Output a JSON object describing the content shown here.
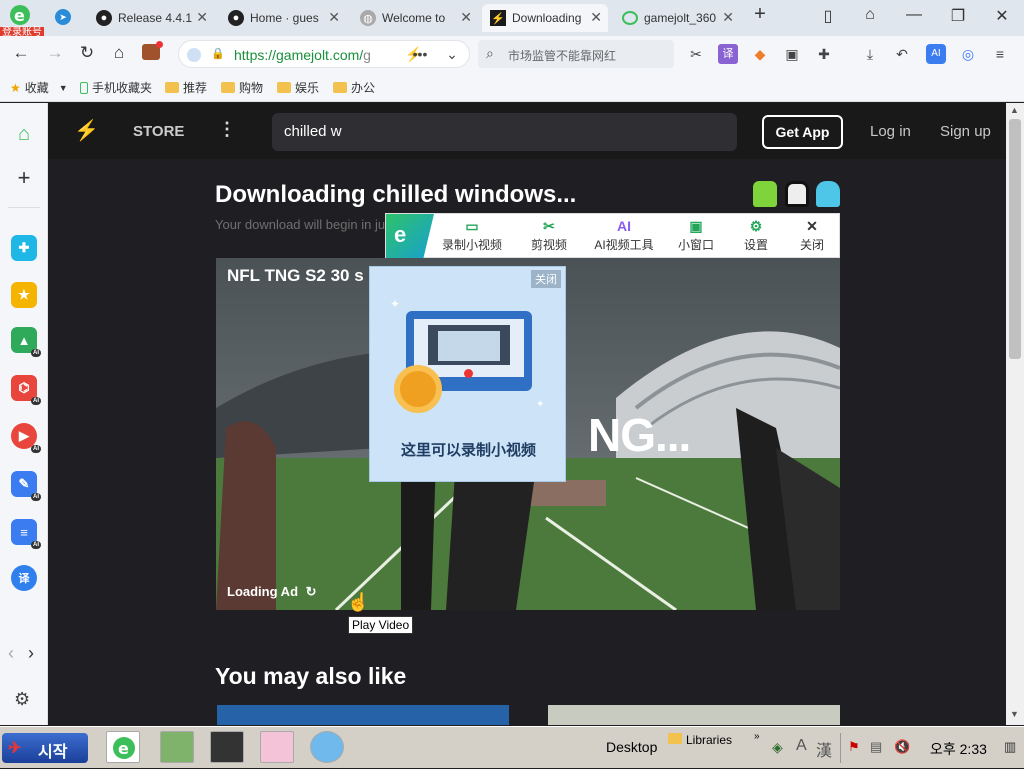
{
  "browser": {
    "badge_label": "登录账号",
    "tabs": [
      {
        "title": "Release 4.4.1",
        "icon": "github-icon"
      },
      {
        "title": "Home · gues",
        "icon": "github-icon"
      },
      {
        "title": "Welcome to",
        "icon": "globe-icon"
      },
      {
        "title": "Downloading",
        "icon": "gamejolt-icon",
        "active": true
      },
      {
        "title": "gamejolt_360",
        "icon": "search-icon"
      }
    ],
    "url_host": "https://gamejolt.com/",
    "url_rest": "g",
    "search_placeholder": "市场监管不能靠网红",
    "bookmarks": [
      {
        "label": "收藏",
        "icon": "star-icon"
      },
      {
        "label": "手机收藏夹",
        "icon": "phone-icon"
      },
      {
        "label": "推荐",
        "icon": "folder-icon"
      },
      {
        "label": "购物",
        "icon": "folder-icon"
      },
      {
        "label": "娱乐",
        "icon": "folder-icon"
      },
      {
        "label": "办公",
        "icon": "folder-icon"
      }
    ]
  },
  "gamejolt": {
    "store_label": "STORE",
    "search_value": "chilled w",
    "get_app_label": "Get App",
    "login_label": "Log in",
    "signup_label": "Sign up",
    "download_title": "Downloading chilled windows...",
    "download_subtitle": "Your download will begin in ju",
    "video_title": "NFL TNG S2 30 s",
    "video_overlay_text": "NG...",
    "loading_ad_label": "Loading Ad",
    "play_tooltip": "Play Video",
    "also_like_heading": "You may also like"
  },
  "recorder": {
    "tools": [
      {
        "label": "录制小视频",
        "icon": "record-video-icon"
      },
      {
        "label": "剪视频",
        "icon": "scissors-icon"
      },
      {
        "label": "AI视频工具",
        "icon": "ai-icon"
      },
      {
        "label": "小窗口",
        "icon": "mini-window-icon"
      },
      {
        "label": "设置",
        "icon": "gear-icon"
      },
      {
        "label": "关闭",
        "icon": "close-icon"
      }
    ],
    "popup_close_label": "关闭",
    "popup_text": "这里可以录制小视频"
  },
  "taskbar": {
    "start_label": "시작",
    "desktop_label": "Desktop",
    "libraries_label": "Libraries",
    "ime_a": "A",
    "ime_han": "漢",
    "clock": "오후 2:33"
  }
}
